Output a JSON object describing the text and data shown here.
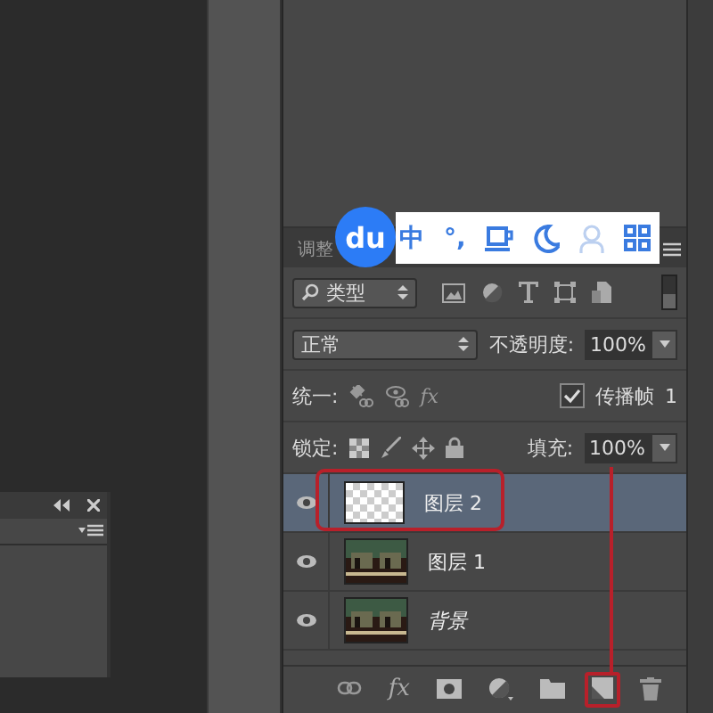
{
  "ime_toolbar": {
    "logo": "du",
    "items": [
      {
        "kind": "text",
        "label": "中"
      },
      {
        "kind": "text",
        "label": "°,"
      },
      {
        "kind": "cup"
      },
      {
        "kind": "moon"
      },
      {
        "kind": "person"
      },
      {
        "kind": "grid"
      }
    ]
  },
  "layers_panel": {
    "tabs": [
      {
        "label": "调整",
        "selected": false
      }
    ],
    "filter": {
      "value": "类型"
    },
    "filter_toggle": {
      "on": false
    },
    "blend_mode": {
      "value": "正常"
    },
    "opacity": {
      "label": "不透明度:",
      "value": "100%"
    },
    "unify": {
      "label": "统一:",
      "icons": [
        {
          "kind": "position"
        },
        {
          "kind": "visibility"
        },
        {
          "kind": "style",
          "label": "fx"
        }
      ]
    },
    "propagate": {
      "label": "传播帧",
      "checked": true,
      "count": "1"
    },
    "lock": {
      "label": "锁定:"
    },
    "fill": {
      "label": "填充:",
      "value": "100%"
    },
    "layers": [
      {
        "name": "图层 2",
        "selected": true,
        "visible": true,
        "thumbnail": {
          "kind": "transparent"
        },
        "kind": "layer"
      },
      {
        "name": "图层 1",
        "selected": false,
        "visible": true,
        "kind": "layer"
      },
      {
        "name": "背景",
        "selected": false,
        "visible": true,
        "kind": "background"
      }
    ],
    "bottom_bar": [
      {
        "kind": "link"
      },
      {
        "kind": "fx",
        "label": "fx"
      },
      {
        "kind": "mask"
      },
      {
        "kind": "adjust"
      },
      {
        "kind": "folder"
      },
      {
        "kind": "new"
      },
      {
        "kind": "trash"
      }
    ]
  }
}
